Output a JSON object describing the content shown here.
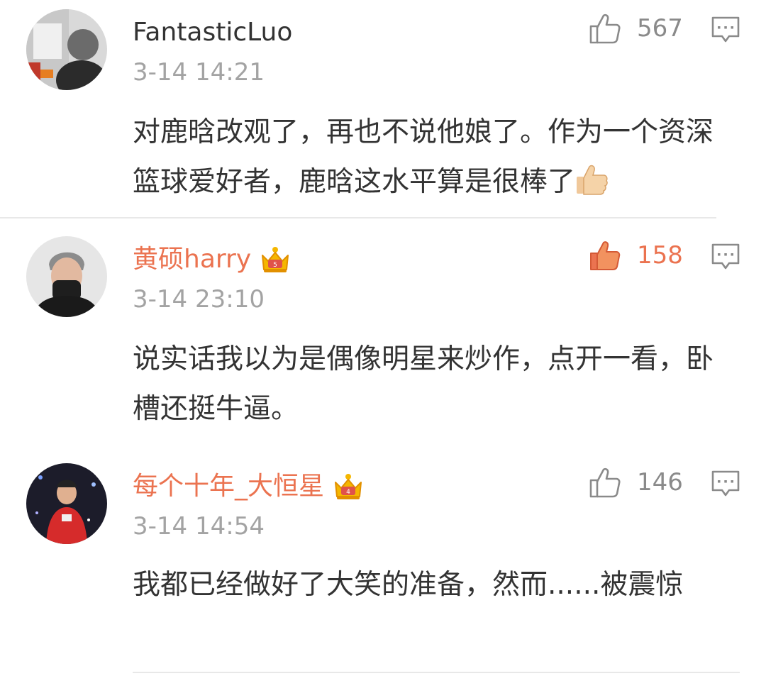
{
  "comments": [
    {
      "username": "FantasticLuo",
      "time": "3-14 14:21",
      "likes": "567",
      "liked": false,
      "vip": false,
      "text": "对鹿晗改观了，再也不说他娘了。作为一个资深篮球爱好者，鹿晗这水平算是很棒了",
      "emoji": "thumbs-up-emoji"
    },
    {
      "username": "黄硕harry",
      "time": "3-14 23:10",
      "likes": "158",
      "liked": true,
      "vip": true,
      "text": "说实话我以为是偶像明星来炒作，点开一看，卧槽还挺牛逼。"
    },
    {
      "username": "每个十年_大恒星",
      "time": "3-14 14:54",
      "likes": "146",
      "liked": false,
      "vip": true,
      "text": "我都已经做好了大笑的准备，然而......被震惊"
    }
  ],
  "colors": {
    "vip_name": "#eb7350",
    "plain_name": "#333333",
    "time": "#a3a3a3",
    "like_gray": "#8a8a8a",
    "like_active": "#eb7350",
    "divider": "#e8e8e8"
  },
  "icons": [
    "thumbs-up-icon",
    "comment-icon",
    "vip-crown-icon",
    "thumbs-up-emoji"
  ]
}
